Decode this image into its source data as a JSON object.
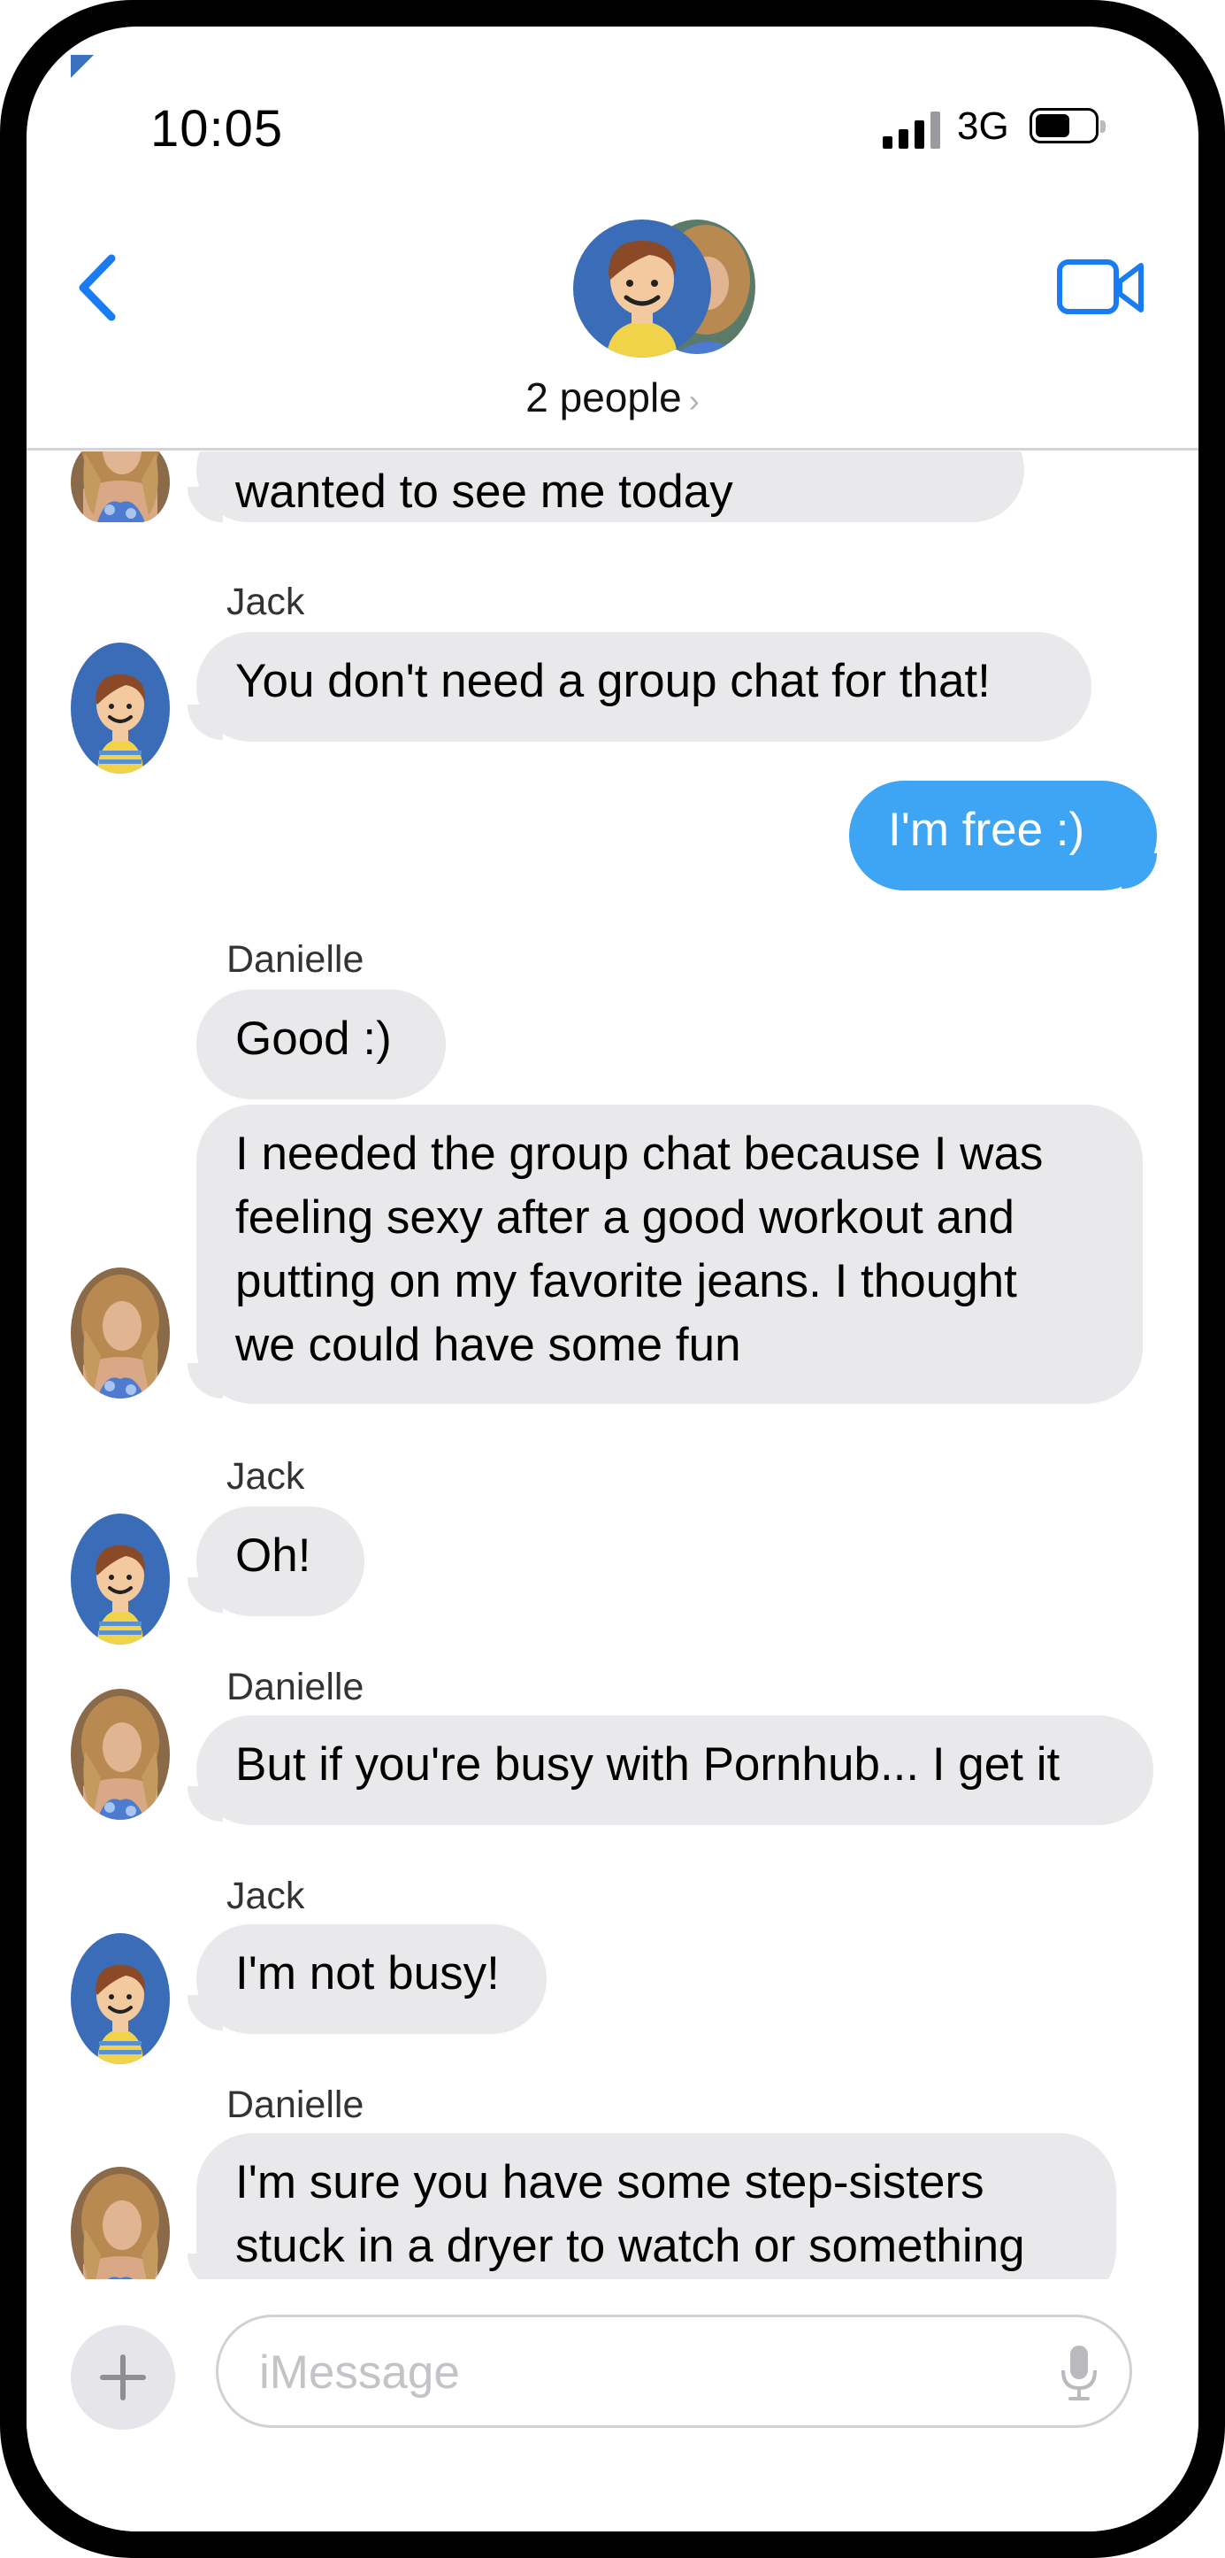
{
  "status_bar": {
    "time": "10:05",
    "network": "3G"
  },
  "header": {
    "group_label": "2 people",
    "group_chevron": "›"
  },
  "messages": [
    {
      "text": "wanted to see me today"
    },
    {
      "sender": "Jack",
      "text": "You don't need a group chat for that!"
    },
    {
      "text": "I'm free :)"
    },
    {
      "sender": "Danielle",
      "text": "Good :)"
    },
    {
      "text": "I needed the group chat because I was\nfeeling sexy after a good workout and\nputting on my favorite jeans.  I thought\nwe could have some fun"
    },
    {
      "sender": "Jack",
      "text": "Oh!"
    },
    {
      "sender": "Danielle",
      "text": "But if you're busy with Pornhub... I get it"
    },
    {
      "sender": "Jack",
      "text": "I'm not busy!"
    },
    {
      "sender": "Danielle",
      "text": "I'm sure you have some step-sisters\nstuck in a dryer to watch or something"
    }
  ],
  "compose": {
    "placeholder": "iMessage",
    "plus_symbol": "+"
  },
  "colors": {
    "accent": "#1a7cf2",
    "outgoing_bubble": "#3ea5f4",
    "incoming_bubble": "#e9e9eb"
  },
  "icons": [
    "back-chevron-icon",
    "video-camera-icon",
    "plus-icon",
    "microphone-icon"
  ]
}
